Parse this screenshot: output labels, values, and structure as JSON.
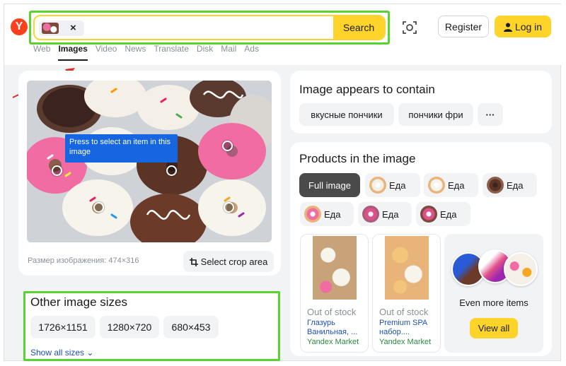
{
  "header": {
    "logo": "Y",
    "search": {
      "placeholder": "",
      "button_label": "Search",
      "chip_close": "×"
    },
    "register_label": "Register",
    "login_label": "Log in",
    "nav": [
      "Web",
      "Images",
      "Video",
      "News",
      "Translate",
      "Disk",
      "Mail",
      "Ads"
    ],
    "active_nav": "Images"
  },
  "image_panel": {
    "tooltip": "Press to select an item in this image",
    "size_text": "Размер изображения: 474×316",
    "crop_button": "Select crop area"
  },
  "other_sizes": {
    "title": "Other image sizes",
    "sizes": [
      "1726×1151",
      "1280×720",
      "680×453"
    ],
    "show_all": "Show all sizes ⌄"
  },
  "contains": {
    "title": "Image appears to contain",
    "tags": [
      "вкусные пончики",
      "пончики фри"
    ],
    "more": "···"
  },
  "products": {
    "title": "Products in the image",
    "full_image_label": "Full image",
    "chips": [
      "Еда",
      "Еда",
      "Еда",
      "Еда",
      "Еда",
      "Еда"
    ],
    "cards": [
      {
        "status": "Out of stock",
        "name": "Глазурь Ванильная, ...",
        "store": "Yandex Market"
      },
      {
        "status": "Out of stock",
        "name": "Premium SPA набор....",
        "store": "Yandex Market"
      }
    ],
    "more_label": "Even more items",
    "view_all": "View all"
  },
  "colors": {
    "accent_yellow": "#fed42b",
    "highlight_green": "#58d330",
    "link_blue": "#1c4fb8",
    "tooltip_blue": "#1566e0",
    "logo_red": "#fc3f1d"
  }
}
